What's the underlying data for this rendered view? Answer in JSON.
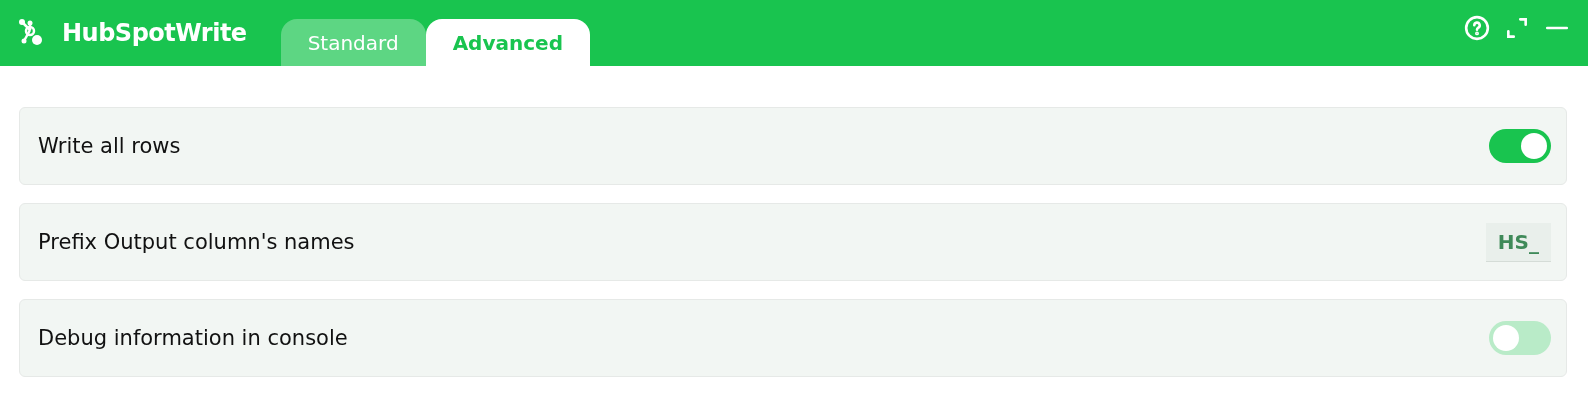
{
  "app": {
    "title": "HubSpotWrite"
  },
  "tabs": [
    {
      "label": "Standard",
      "selected": false
    },
    {
      "label": "Advanced",
      "selected": true
    }
  ],
  "settings": [
    {
      "kind": "toggle",
      "label": "Write all rows",
      "on": true
    },
    {
      "kind": "text",
      "label": "Prefix Output column's names",
      "value": "HS_"
    },
    {
      "kind": "toggle",
      "label": "Debug information in console",
      "on": false
    }
  ]
}
